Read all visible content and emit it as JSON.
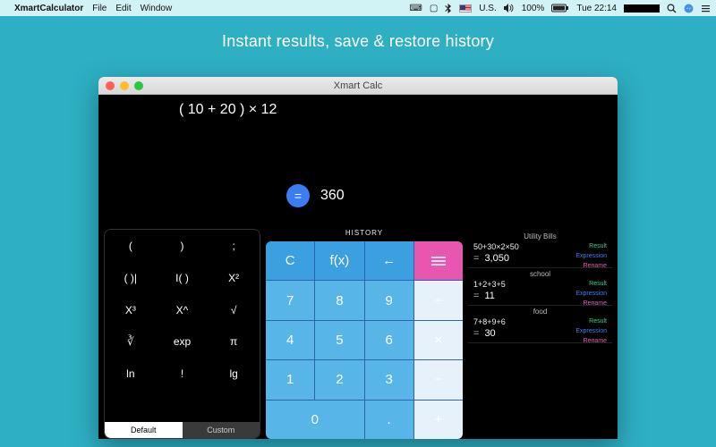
{
  "menubar": {
    "app": "XmartCalculator",
    "items": [
      "File",
      "Edit",
      "Window"
    ],
    "right": {
      "locale": "U.S.",
      "volume_pct": "100%",
      "clock": "Tue 22:14"
    }
  },
  "tagline": "Instant results, save & restore history",
  "window": {
    "title": "Xmart Calc",
    "expression": "( 10 + 20 ) × 12",
    "equals": "=",
    "result": "360"
  },
  "advanced": {
    "rows": [
      [
        "(",
        ")",
        ";"
      ],
      [
        "( )|",
        "I( )",
        "X²"
      ],
      [
        "X³",
        "X^",
        "√"
      ],
      [
        "∛",
        "exp",
        "π"
      ],
      [
        "ln",
        "!",
        "lg"
      ],
      [
        "",
        "",
        ""
      ]
    ],
    "tab_default": "Default",
    "tab_custom": "Custom"
  },
  "center": {
    "history_label": "HISTORY",
    "keys": {
      "clear": "C",
      "fx": "f(x)",
      "back": "←",
      "k7": "7",
      "k8": "8",
      "k9": "9",
      "div": "÷",
      "k4": "4",
      "k5": "5",
      "k6": "6",
      "mul": "×",
      "k1": "1",
      "k2": "2",
      "k3": "3",
      "sub": "−",
      "k0": "0",
      "dot": ".",
      "add": "+"
    }
  },
  "history": {
    "links": {
      "result": "Result",
      "expression": "Expression",
      "rename": "Rename"
    },
    "items": [
      {
        "title": "Utility Bills",
        "expr": "50+30×2×50",
        "result": "3,050"
      },
      {
        "title": "school",
        "expr": "1+2+3+5",
        "result": "11"
      },
      {
        "title": "food",
        "expr": "7+8+9+6",
        "result": "30"
      }
    ]
  }
}
